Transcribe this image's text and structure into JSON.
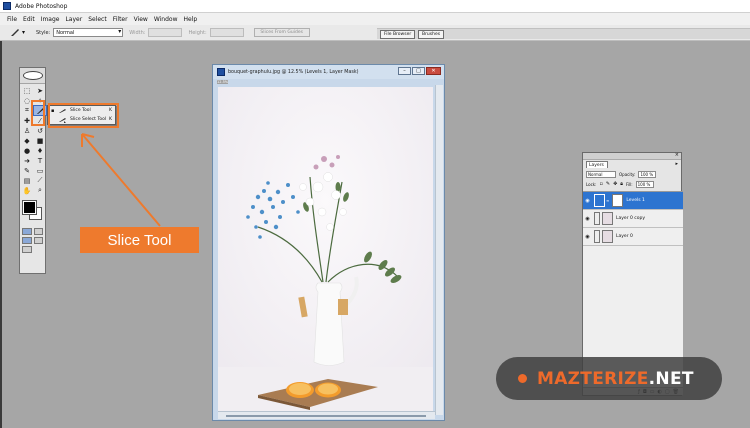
{
  "app": {
    "title": "Adobe Photoshop"
  },
  "menu": [
    "File",
    "Edit",
    "Image",
    "Layer",
    "Select",
    "Filter",
    "View",
    "Window",
    "Help"
  ],
  "options_bar": {
    "style_label": "Style:",
    "style_value": "Normal",
    "width_label": "Width:",
    "height_label": "Height:",
    "guides_button": "Slices From Guides",
    "palette_tabs": [
      "File Browser",
      "Brushes"
    ]
  },
  "flyout": {
    "items": [
      {
        "label": "Slice Tool",
        "shortcut": "K",
        "selected": true
      },
      {
        "label": "Slice Select Tool",
        "shortcut": "K",
        "selected": false
      }
    ]
  },
  "callout": {
    "label": "Slice Tool",
    "color": "#ee7a2d"
  },
  "document": {
    "title": "bouquet-graphulu.jpg @ 12.5% (Levels 1, Layer Mask)",
    "zoom_label": "12.5%"
  },
  "layers_panel": {
    "tab": "Layers",
    "blend_mode": "Normal",
    "opacity_label": "Opacity:",
    "opacity_value": "100 %",
    "lock_label": "Lock:",
    "fill_label": "Fill:",
    "fill_value": "100 %",
    "layers": [
      {
        "name": "Levels 1",
        "selected": true,
        "kind": "adjustment"
      },
      {
        "name": "Layer 0 copy",
        "selected": false,
        "kind": "image"
      },
      {
        "name": "Layer 0",
        "selected": false,
        "kind": "image"
      }
    ]
  },
  "watermark": {
    "brand": "MAZTERIZE",
    "suffix": ".NET",
    "accent": "#ee6a2b"
  }
}
